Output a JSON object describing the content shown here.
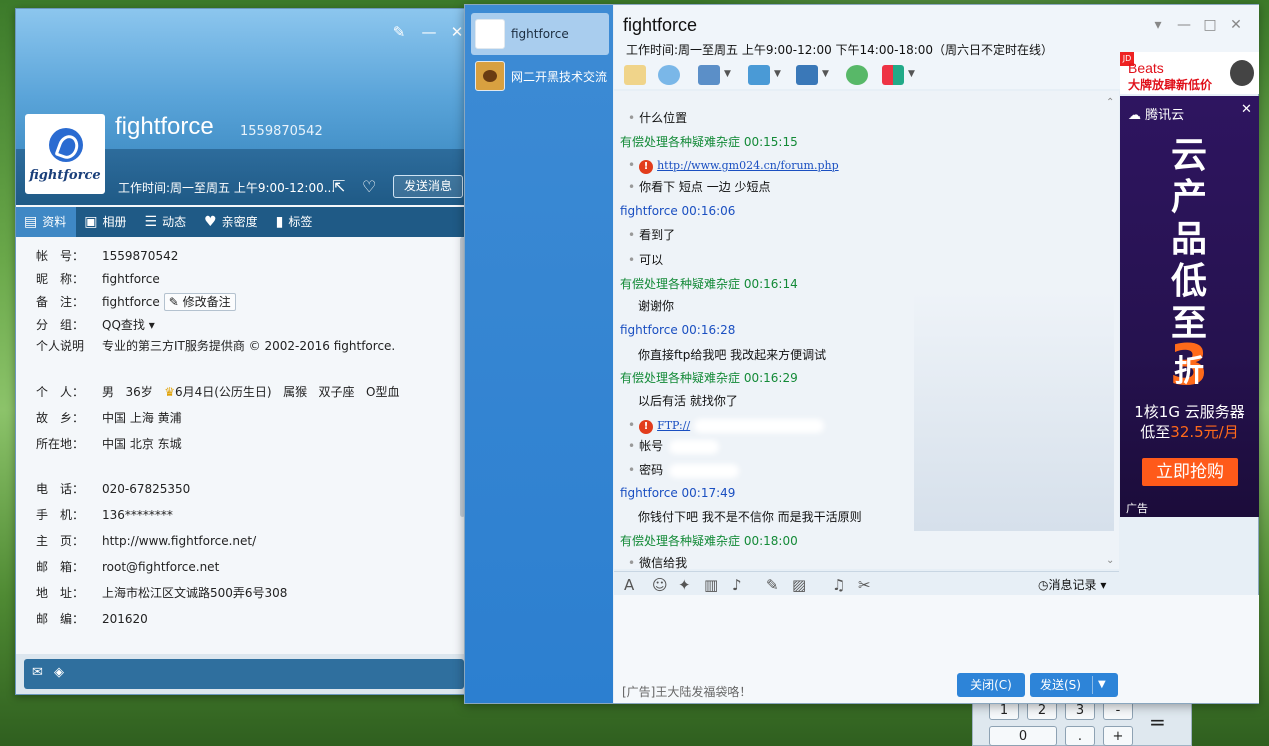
{
  "profile": {
    "name": "fightforce",
    "qq": "1559870542",
    "logo_text": "fightforce",
    "hours": "工作时间:周一至周五 上午9:00-12:00...",
    "send_message": "发送消息",
    "tabs": [
      {
        "label": "资料",
        "icon": "profile-card-icon"
      },
      {
        "label": "相册",
        "icon": "album-icon"
      },
      {
        "label": "动态",
        "icon": "feed-icon"
      },
      {
        "label": "亲密度",
        "icon": "heart-icon"
      },
      {
        "label": "标签",
        "icon": "bookmark-icon"
      }
    ],
    "fields": {
      "account_label": "帐　号：",
      "account": "1559870542",
      "nickname_label": "昵　称：",
      "nickname": "fightforce",
      "remark_label": "备　注：",
      "remark": "fightforce",
      "edit_remark": "修改备注",
      "group_label": "分　组：",
      "group": "QQ查找",
      "intro_label": "个人说明",
      "intro": "专业的第三方IT服务提供商 © 2002-2016 fightforce.",
      "personal_label": "个　人：",
      "gender": "男",
      "age": "36岁",
      "birthday": "6月4日(公历生日)",
      "zodiac": "属猴",
      "constellation": "双子座",
      "blood": "O型血",
      "hometown_label": "故　乡：",
      "hometown": "中国 上海 黄浦",
      "location_label": "所在地：",
      "location": "中国 北京 东城",
      "phone_label": "电　话：",
      "phone": "020-67825350",
      "mobile_label": "手　机：",
      "mobile": "136********",
      "homepage_label": "主　页：",
      "homepage": "http://www.fightforce.net/",
      "email_label": "邮　箱：",
      "email": "root@fightforce.net",
      "address_label": "地　址：",
      "address": "上海市松江区文诚路500弄6号308",
      "zip_label": "邮　编：",
      "zip": "201620"
    }
  },
  "chat": {
    "title": "fightforce",
    "hours": "工作时间:周一至周五 上午9:00-12:00 下午14:00-18:00（周六日不定时在线）",
    "contacts": [
      {
        "name": "fightforce"
      },
      {
        "name": "网二开黑技术交流"
      }
    ],
    "messages": {
      "m1": "什么位置",
      "s1": "有偿处理各种疑难杂症  00:15:15",
      "m2": "http://www.gm024.cn/forum.php",
      "m3": "你看下  短点 一边 少短点",
      "s2": "fightforce  00:16:06",
      "m4": "看到了",
      "m5": "可以",
      "s3": "有偿处理各种疑难杂症  00:16:14",
      "m6": "谢谢你",
      "s4": "fightforce  00:16:28",
      "m7": "你直接ftp给我吧 我改起来方便调试",
      "s5": "有偿处理各种疑难杂症  00:16:29",
      "m8": "以后有活 就找你了",
      "m9": "FTP://",
      "m10": "帐号",
      "m11": "密码",
      "s6": "fightforce  00:17:49",
      "m12": "你钱付下吧 我不是不信你 而是我干活原则",
      "s7": "有偿处理各种疑难杂症  00:18:00",
      "m13": "微信给我"
    },
    "history": "消息记录",
    "ad_text": "[广告]王大陆发福袋咯！",
    "close": "关闭(C)",
    "send": "发送(S)"
  },
  "ads": {
    "top_brand": "Beats",
    "top_promo": "大牌放肆新低价",
    "jd": "JD",
    "main_logo": "腾讯云",
    "main_chars": [
      "云",
      "产",
      "品",
      "低",
      "至"
    ],
    "main_three": "3",
    "main_zhe": "折",
    "spec_line1": "1核1G 云服务器",
    "spec_prefix": "低至",
    "spec_price": "32.5元/月",
    "buy": "立即抢购",
    "label": "广告"
  },
  "calc": {
    "keys": [
      "1",
      "2",
      "3",
      "-",
      "0",
      ".",
      "+",
      "="
    ]
  }
}
